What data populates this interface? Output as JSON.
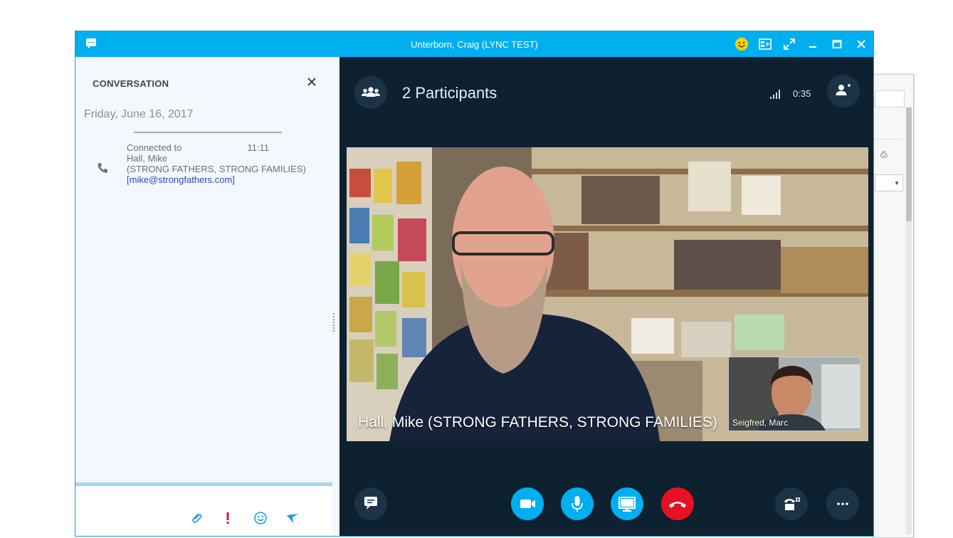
{
  "window": {
    "title": "Unterborn, Craig (LYNC TEST)"
  },
  "conversation": {
    "header": "CONVERSATION",
    "date": "Friday, June 16, 2017",
    "entry": {
      "status": "Connected to",
      "time": "11:11",
      "name": "Hall, Mike",
      "org": "(STRONG FATHERS, STRONG FAMILIES)",
      "email": "[mike@strongfathers.com]"
    }
  },
  "call": {
    "participants_label": "2 Participants",
    "timer": "0:35",
    "main_caption": "Hall, Mike (STRONG FATHERS, STRONG FAMILIES)",
    "self_view_label": "Seigfred, Marc"
  },
  "colors": {
    "accent": "#00aff0",
    "hangup": "#e81123",
    "call_background": "#0d2131"
  },
  "icons": {
    "app": "skype-logo-icon",
    "emoticon": "smiley-icon",
    "layout": "layout-icon",
    "fullscreen": "expand-icon",
    "minimize": "minimize-icon",
    "maximize": "maximize-icon",
    "close": "close-icon"
  }
}
